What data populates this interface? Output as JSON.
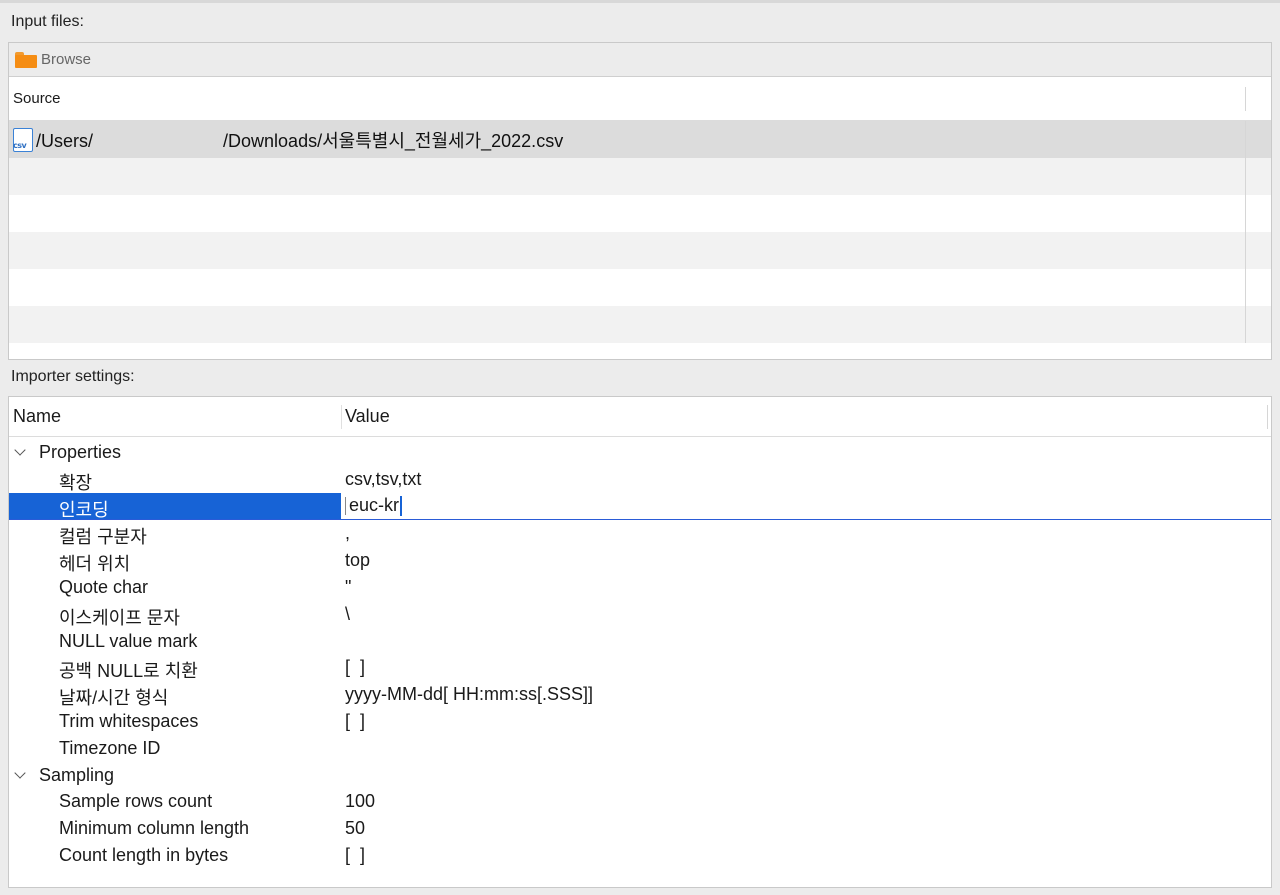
{
  "input_files": {
    "label": "Input files:",
    "toolbar": {
      "browse_label": "Browse",
      "browse_icon": "folder-icon"
    },
    "source_header": "Source",
    "files": [
      {
        "icon": "csv-file-icon",
        "icon_text": "csv",
        "path": "/Users/                          /Downloads/서울특별시_전월세가_2022.csv"
      }
    ]
  },
  "importer_settings": {
    "label": "Importer settings:",
    "columns": {
      "name": "Name",
      "value": "Value"
    },
    "groups": [
      {
        "name": "Properties",
        "items": [
          {
            "name": "확장",
            "value": "csv,tsv,txt"
          },
          {
            "name": "인코딩",
            "value": "euc-kr"
          },
          {
            "name": "컬럼 구분자",
            "value": ","
          },
          {
            "name": "헤더 위치",
            "value": "top"
          },
          {
            "name": "Quote char",
            "value": "\""
          },
          {
            "name": "이스케이프 문자",
            "value": "\\"
          },
          {
            "name": "NULL value mark",
            "value": ""
          },
          {
            "name": "공백 NULL로 치환",
            "value": "[  ]"
          },
          {
            "name": "날짜/시간 형식",
            "value": "yyyy-MM-dd[ HH:mm:ss[.SSS]]"
          },
          {
            "name": "Trim whitespaces",
            "value": "[  ]"
          },
          {
            "name": "Timezone ID",
            "value": ""
          }
        ]
      },
      {
        "name": "Sampling",
        "items": [
          {
            "name": "Sample rows count",
            "value": "100"
          },
          {
            "name": "Minimum column length",
            "value": "50"
          },
          {
            "name": "Count length in bytes",
            "value": "[  ]"
          }
        ]
      }
    ]
  },
  "colors": {
    "selection": "#1763d6",
    "folder": "#f58d14",
    "csv_icon": "#3b82d6"
  }
}
